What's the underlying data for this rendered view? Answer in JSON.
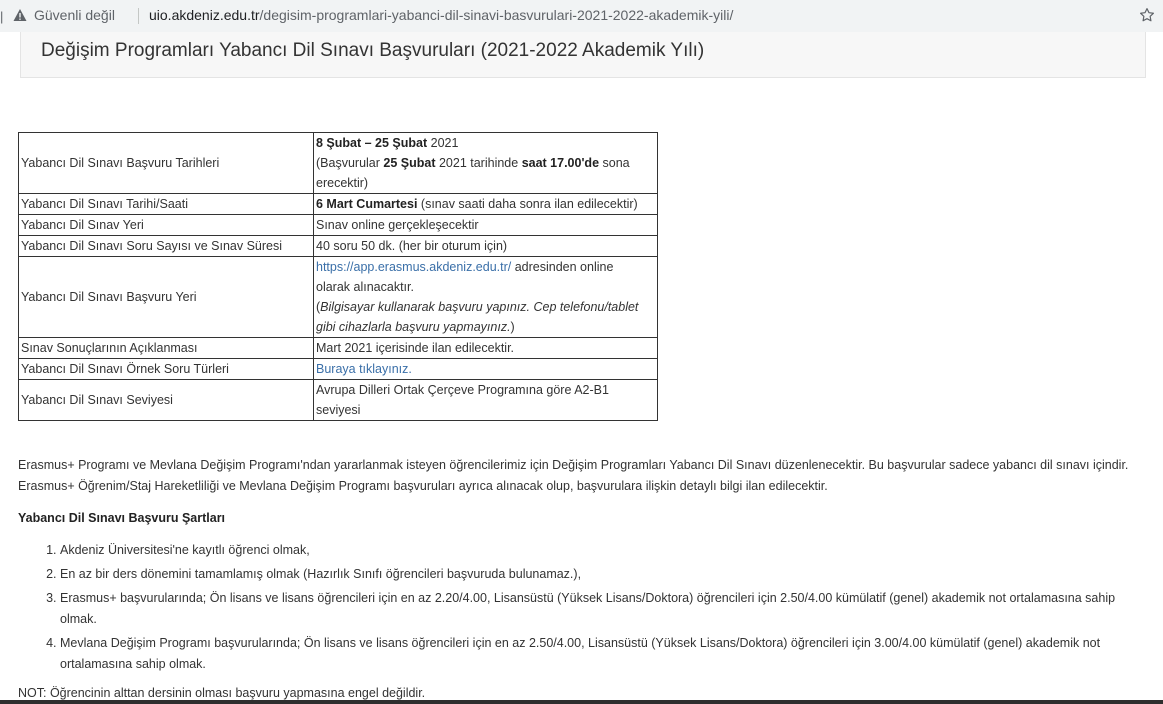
{
  "browser": {
    "insecure_label": "Güvenli değil",
    "url_host": "uio.akdeniz.edu.tr",
    "url_path": "/degisim-programlari-yabanci-dil-sinavi-basvurulari-2021-2022-akademik-yili/"
  },
  "page": {
    "title": "Değişim Programları Yabancı Dil Sınavı Başvuruları (2021-2022 Akademik Yılı)"
  },
  "table": {
    "r1": {
      "label": "Yabancı Dil Sınavı Başvuru Tarihleri",
      "dates": "8 Şubat – 25 Şubat",
      "year": " 2021",
      "l2a": "(Başvurular ",
      "l2b": "25 Şubat",
      "l2c": " 2021 tarihinde ",
      "l2d": "saat 17.00'de",
      "l2e": " sona",
      "l3": "erecektir)"
    },
    "r2": {
      "label": "Yabancı Dil Sınavı Tarihi/Saati",
      "bold": "6 Mart Cumartesi",
      "rest": " (sınav saati daha sonra ilan edilecektir)"
    },
    "r3": {
      "label": "Yabancı Dil Sınav Yeri",
      "value": "Sınav online gerçekleşecektir"
    },
    "r4": {
      "label": "Yabancı Dil Sınavı Soru Sayısı ve Sınav Süresi",
      "value": "40 soru 50 dk. (her bir oturum için)"
    },
    "r5": {
      "label": "Yabancı Dil Sınavı Başvuru Yeri",
      "link": "https://app.erasmus.akdeniz.edu.tr/",
      "l1rest": " adresinden online",
      "l2": "olarak alınacaktır.",
      "l3open": "(",
      "l3italic": "Bilgisayar kullanarak başvuru yapınız. Cep telefonu/tablet",
      "l4italic": "gibi cihazlarla başvuru yapmayınız.",
      "l4close": ")"
    },
    "r6": {
      "label": "Sınav Sonuçlarının Açıklanması",
      "value": "Mart 2021 içerisinde ilan edilecektir."
    },
    "r7": {
      "label": "Yabancı Dil Sınavı Örnek Soru Türleri",
      "link": "Buraya tıklayınız."
    },
    "r8": {
      "label": "Yabancı Dil Sınavı Seviyesi",
      "l1": "Avrupa Dilleri Ortak Çerçeve Programına göre A2-B1",
      "l2": "seviyesi"
    }
  },
  "paragraph": "Erasmus+ Programı ve Mevlana Değişim Programı'ndan yararlanmak isteyen öğrencilerimiz için Değişim Programları Yabancı Dil Sınavı düzenlenecektir. Bu başvurular sadece yabancı dil sınavı içindir. Erasmus+ Öğrenim/Staj Hareketliliği ve Mevlana Değişim Programı başvuruları ayrıca alınacak olup, başvurulara ilişkin detaylı bilgi ilan edilecektir.",
  "requirements": {
    "title": "Yabancı Dil Sınavı Başvuru Şartları",
    "items": [
      "Akdeniz Üniversitesi'ne kayıtlı öğrenci olmak,",
      "En az bir ders dönemini tamamlamış olmak (Hazırlık Sınıfı öğrencileri başvuruda bulunamaz.),",
      "Erasmus+ başvurularında; Ön lisans ve lisans öğrencileri için en az 2.20/4.00, Lisansüstü (Yüksek Lisans/Doktora) öğrencileri için 2.50/4.00 kümülatif (genel) akademik not ortalamasına sahip olmak.",
      "Mevlana Değişim Programı başvurularında; Ön lisans ve lisans öğrencileri için en az 2.50/4.00, Lisansüstü (Yüksek Lisans/Doktora) öğrencileri için 3.00/4.00 kümülatif (genel) akademik not ortalamasına sahip olmak."
    ]
  },
  "note": "NOT: Öğrencinin alttan dersinin olması başvuru yapmasına engel değildir.",
  "colors": {
    "link": "#3a6fa8",
    "title_bg": "#f7f7f7",
    "addr_bg": "#f1f3f4"
  }
}
